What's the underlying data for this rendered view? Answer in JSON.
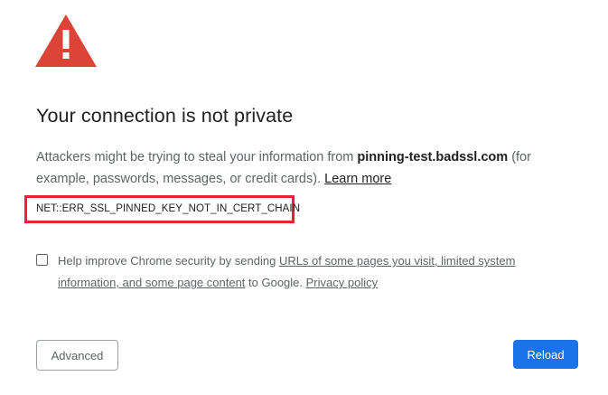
{
  "icon": {
    "name": "warning-icon",
    "color": "#db4437"
  },
  "heading": "Your connection is not private",
  "explanation": {
    "prefix": "Attackers might be trying to steal your information from ",
    "host": "pinning-test.badssl.com",
    "suffix": " (for example, passwords, messages, or credit cards). ",
    "learn_more": "Learn more"
  },
  "error_code": "NET::ERR_SSL_PINNED_KEY_NOT_IN_CERT_CHAIN",
  "highlight_color": "#e5262e",
  "optin": {
    "checked": false,
    "prefix": "Help improve Chrome security by sending ",
    "link": "URLs of some pages you visit, limited system information, and some page content",
    "middle": " to Google. ",
    "privacy_link": "Privacy policy"
  },
  "buttons": {
    "advanced": "Advanced",
    "reload": "Reload"
  },
  "accent_color": "#1a73e8"
}
